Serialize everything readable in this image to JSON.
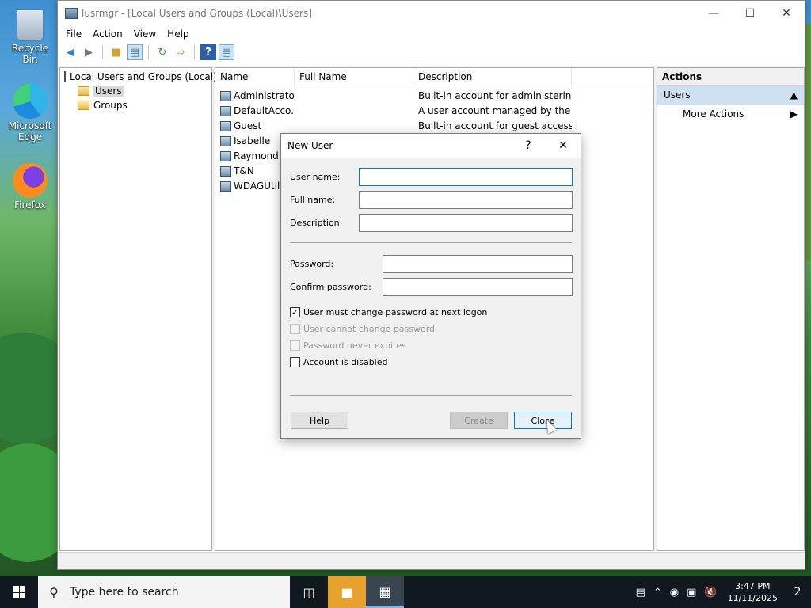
{
  "desktop": {
    "icons": [
      {
        "label": "Recycle Bin"
      },
      {
        "label": "Microsoft Edge"
      },
      {
        "label": "Firefox"
      }
    ]
  },
  "window": {
    "title": "lusrmgr - [Local Users and Groups (Local)\\Users]",
    "menu": [
      "File",
      "Action",
      "View",
      "Help"
    ],
    "tree": {
      "root": "Local Users and Groups (Local)",
      "items": [
        "Users",
        "Groups"
      ]
    },
    "list": {
      "columns": [
        "Name",
        "Full Name",
        "Description"
      ],
      "rows": [
        {
          "name": "Administrator",
          "full_name": "",
          "description": "Built-in account for administering..."
        },
        {
          "name": "DefaultAcco...",
          "full_name": "",
          "description": "A user account managed by the s..."
        },
        {
          "name": "Guest",
          "full_name": "",
          "description": "Built-in account for guest access t..."
        },
        {
          "name": "Isabelle",
          "full_name": "",
          "description": ""
        },
        {
          "name": "Raymond",
          "full_name": "",
          "description": ""
        },
        {
          "name": "T&N",
          "full_name": "",
          "description": ""
        },
        {
          "name": "WDAGUtilit",
          "full_name": "",
          "description": ""
        }
      ]
    },
    "actions": {
      "header": "Actions",
      "section": "Users",
      "items": [
        "More Actions"
      ]
    }
  },
  "dialog": {
    "title": "New User",
    "help_glyph": "?",
    "fields": {
      "username_label": "User name:",
      "fullname_label": "Full name:",
      "description_label": "Description:",
      "password_label": "Password:",
      "confirm_label": "Confirm password:",
      "username_value": "",
      "fullname_value": "",
      "description_value": "",
      "password_value": "",
      "confirm_value": ""
    },
    "checkboxes": [
      {
        "label": "User must change password at next logon",
        "checked": true,
        "enabled": true
      },
      {
        "label": "User cannot change password",
        "checked": false,
        "enabled": false
      },
      {
        "label": "Password never expires",
        "checked": false,
        "enabled": false
      },
      {
        "label": "Account is disabled",
        "checked": false,
        "enabled": true
      }
    ],
    "buttons": {
      "help": "Help",
      "create": "Create",
      "close": "Close"
    }
  },
  "taskbar": {
    "search_placeholder": "Type here to search",
    "time": "3:47 PM",
    "date": "11/11/2025",
    "notification_count": "2"
  }
}
